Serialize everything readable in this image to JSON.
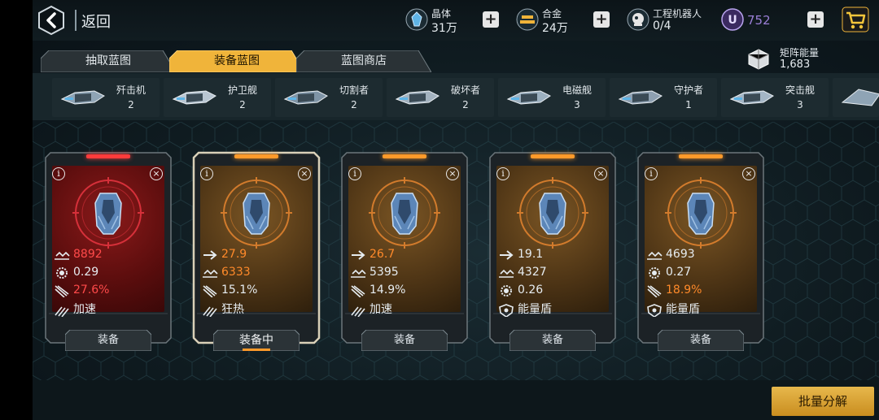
{
  "header": {
    "back_label": "返回",
    "resources": [
      {
        "name": "晶体",
        "value": "31万",
        "icon": "crystal-icon"
      },
      {
        "name": "合金",
        "value": "24万",
        "icon": "alloy-icon"
      },
      {
        "name": "工程机器人",
        "value": "0/4",
        "icon": "robot-icon"
      }
    ],
    "premium": {
      "letter": "U",
      "value": "752",
      "icon": "u-coin-icon"
    },
    "cart_icon": "shopping-cart-icon"
  },
  "tabs": [
    {
      "label": "抽取蓝图",
      "active": false
    },
    {
      "label": "装备蓝图",
      "active": true
    },
    {
      "label": "蓝图商店",
      "active": false
    }
  ],
  "matrix_energy": {
    "label": "矩阵能量",
    "value": "1,683",
    "icon": "matrix-cube-icon"
  },
  "ships": [
    {
      "name": "歼击机",
      "count": "2"
    },
    {
      "name": "护卫舰",
      "count": "2"
    },
    {
      "name": "切割者",
      "count": "2"
    },
    {
      "name": "破坏者",
      "count": "2"
    },
    {
      "name": "电磁舰",
      "count": "3"
    },
    {
      "name": "守护者",
      "count": "1"
    },
    {
      "name": "突击舰",
      "count": "3"
    }
  ],
  "cards": [
    {
      "theme": "red",
      "stats": [
        {
          "icon": "armor-icon",
          "value": "8892",
          "color": "#ff4a4a"
        },
        {
          "icon": "gear-icon",
          "value": "0.29",
          "color": "#e6ecf0"
        },
        {
          "icon": "missile-icon",
          "value": "27.6%",
          "color": "#ff4a4a"
        },
        {
          "icon": "boost-icon",
          "value": "加速",
          "color": "#e6ecf0"
        }
      ],
      "button": "装备"
    },
    {
      "theme": "orange",
      "selected": true,
      "stats": [
        {
          "icon": "arrow-icon",
          "value": "27.9",
          "color": "#ff8a2a"
        },
        {
          "icon": "armor-icon",
          "value": "6333",
          "color": "#ff8a2a"
        },
        {
          "icon": "missile-icon",
          "value": "15.1%",
          "color": "#e6ecf0"
        },
        {
          "icon": "boost-icon",
          "value": "狂热",
          "color": "#e6ecf0"
        }
      ],
      "button": "装备中"
    },
    {
      "theme": "orange",
      "stats": [
        {
          "icon": "arrow-icon",
          "value": "26.7",
          "color": "#ff8a2a"
        },
        {
          "icon": "armor-icon",
          "value": "5395",
          "color": "#e6ecf0"
        },
        {
          "icon": "missile-icon",
          "value": "14.9%",
          "color": "#e6ecf0"
        },
        {
          "icon": "boost-icon",
          "value": "加速",
          "color": "#e6ecf0"
        }
      ],
      "button": "装备"
    },
    {
      "theme": "orange",
      "stats": [
        {
          "icon": "arrow-icon",
          "value": "19.1",
          "color": "#e6ecf0"
        },
        {
          "icon": "armor-icon",
          "value": "4327",
          "color": "#e6ecf0"
        },
        {
          "icon": "gear-icon",
          "value": "0.26",
          "color": "#e6ecf0"
        },
        {
          "icon": "shield-icon",
          "value": "能量盾",
          "color": "#e6ecf0"
        }
      ],
      "button": "装备"
    },
    {
      "theme": "orange",
      "stats": [
        {
          "icon": "armor-icon",
          "value": "4693",
          "color": "#e6ecf0"
        },
        {
          "icon": "gear-icon",
          "value": "0.27",
          "color": "#e6ecf0"
        },
        {
          "icon": "missile-icon",
          "value": "18.9%",
          "color": "#ff8a2a"
        },
        {
          "icon": "shield-icon",
          "value": "能量盾",
          "color": "#e6ecf0"
        }
      ],
      "button": "装备"
    }
  ],
  "batch_button": "批量分解",
  "colors": {
    "accent": "#f0b43a",
    "red": "#ff4a4a",
    "orange": "#ff8a2a",
    "premium": "#9b7fd6"
  }
}
